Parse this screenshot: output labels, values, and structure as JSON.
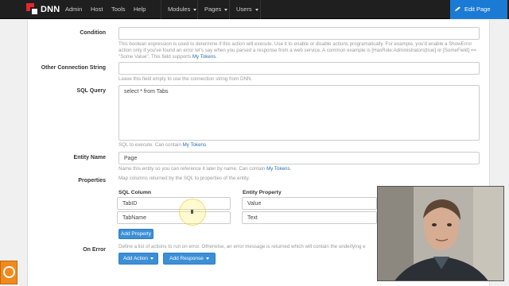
{
  "topbar": {
    "logo_text": "DNN",
    "nav": [
      "Admin",
      "Host",
      "Tools",
      "Help"
    ],
    "dropdowns": [
      "Modules",
      "Pages",
      "Users"
    ],
    "edit_page": "Edit Page"
  },
  "form": {
    "condition": {
      "label": "Condition",
      "value": "",
      "help_pre": "This boolean expression is used to determine if this action will execute. Use it to enable or disable actions programatically. For example, you'd enable a ShowError action only if you've found an error let's say when you parsed a response from a web service. A common example is [HasRole:Administrators|true] or [SomeField] == \"Some Value\". This field supports ",
      "help_link": "My Tokens",
      "help_post": "."
    },
    "other_connection": {
      "label": "Other Connection String",
      "value": "",
      "help": "Leave this field empty to use the connection string from DNN."
    },
    "sql_query": {
      "label": "SQL Query",
      "value": "select * from Tabs",
      "help_pre": "SQL to execute. Can contain ",
      "help_link": "My Tokens",
      "help_post": "."
    },
    "entity_name": {
      "label": "Entity Name",
      "value": "Page",
      "help_pre": "Name this entity so you can reference it later by name. Can contain ",
      "help_link": "My Tokens",
      "help_post": "."
    },
    "properties": {
      "label": "Properties",
      "help": "Map columns returned by the SQL to properties of the entity.",
      "col_sql": "SQL Column",
      "col_entity": "Entity Property",
      "rows": [
        {
          "sql": "TabID",
          "entity": "Value"
        },
        {
          "sql": "TabName",
          "entity": "Text"
        }
      ],
      "add_button": "Add Property"
    },
    "on_error": {
      "label": "On Error",
      "help": "Define a list of actions to run on error. Otherwise, an error message is returned which will contain the underlying e",
      "add_action": "Add Action",
      "add_response": "Add Response"
    }
  },
  "colors": {
    "topbar": "#1f1f1f",
    "accent_blue": "#1a7ad4",
    "button_blue": "#3c8fd6",
    "link_blue": "#2a6fb5",
    "widget_orange": "#f18a1e"
  }
}
